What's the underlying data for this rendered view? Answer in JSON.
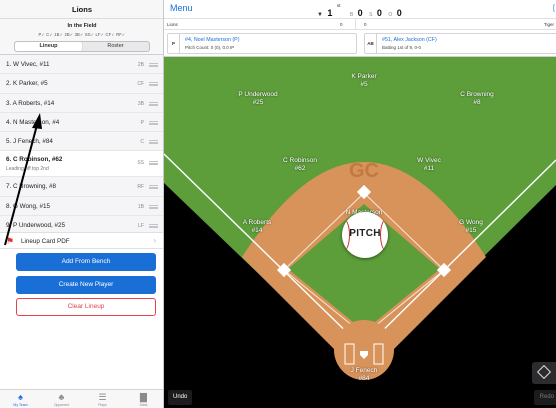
{
  "left": {
    "team_name": "Lions",
    "in_field_title": "In the Field",
    "position_status": "P✓  C✓  1B✓  2B✓  3B✓  SS✓  LF✓  CF✓  RF✓",
    "tabs": [
      {
        "label": "Lineup",
        "active": true
      },
      {
        "label": "Roster",
        "active": false
      }
    ],
    "lineup": [
      {
        "name": "1. W Vivec, #11",
        "pos": "2B"
      },
      {
        "name": "2. K Parker, #5",
        "pos": "CF"
      },
      {
        "name": "3. A Roberts, #14",
        "pos": "3B"
      },
      {
        "name": "4. N Masterson, #4",
        "pos": "P"
      },
      {
        "name": "5. J Fenech, #84",
        "pos": "C"
      },
      {
        "name": "6. C Robinson, #62",
        "pos": "SS",
        "sub": "Leading off top 2nd",
        "current": true
      },
      {
        "name": "7. C Browning, #8",
        "pos": "RF"
      },
      {
        "name": "8. G Wong, #15",
        "pos": "1B"
      },
      {
        "name": "9. P Underwood, #25",
        "pos": "LF"
      }
    ],
    "pdf_label": "Lineup Card PDF",
    "buttons": {
      "add_from_bench": "Add From Bench",
      "create_player": "Create New Player",
      "clear_lineup": "Clear Lineup"
    },
    "tabbar": [
      {
        "label": "My Team",
        "icon": "jersey-outline-icon",
        "glyph": "♠",
        "active": true
      },
      {
        "label": "Opponent",
        "icon": "jersey-filled-icon",
        "glyph": "♣",
        "active": false
      },
      {
        "label": "Plays",
        "icon": "list-icon",
        "glyph": "☰",
        "active": false
      },
      {
        "label": "Stats",
        "icon": "bar-chart-icon",
        "glyph": "▇",
        "active": false
      }
    ]
  },
  "right": {
    "menu_label": "Menu",
    "inning": {
      "arrow": "▼",
      "number": "1",
      "suffix": "st"
    },
    "count": [
      {
        "label": "B",
        "value": "0"
      },
      {
        "label": "S",
        "value": "0"
      },
      {
        "label": "O",
        "value": "0"
      }
    ],
    "right_edge_glyph": "[",
    "scoreboard": {
      "team": "Lions",
      "score1": "0",
      "score2": "0",
      "right_label": "Tiger"
    },
    "pitcher": {
      "tag": "P",
      "name": "#4, Noel Masterson (P)",
      "info": "Pitch Count: 0 (0), 0.0 IP"
    },
    "batter": {
      "tag": "AB",
      "name": "#51, Alex Jackson (CF)",
      "info": "Batting 1st of 9, 0-0"
    },
    "field_logo": "GC",
    "players": [
      {
        "name": "K Parker",
        "number": "#5"
      },
      {
        "name": "P Underwood",
        "number": "#25"
      },
      {
        "name": "C Browning",
        "number": "#8"
      },
      {
        "name": "C Robinson",
        "number": "#62"
      },
      {
        "name": "W Vivec",
        "number": "#11"
      },
      {
        "name": "A Roberts",
        "number": "#14"
      },
      {
        "name": "N Masterson",
        "number": "#4"
      },
      {
        "name": "G Wong",
        "number": "#15"
      },
      {
        "name": "J Fenech",
        "number": "#84"
      }
    ],
    "pitch_label": "PITCH",
    "undo_label": "Undo",
    "redo_label": "Redo",
    "colors": {
      "grass": "#5d9e3a",
      "dirt": "#d8935a",
      "accent_blue": "#1a6fd6",
      "danger_red": "#e5414f"
    }
  }
}
